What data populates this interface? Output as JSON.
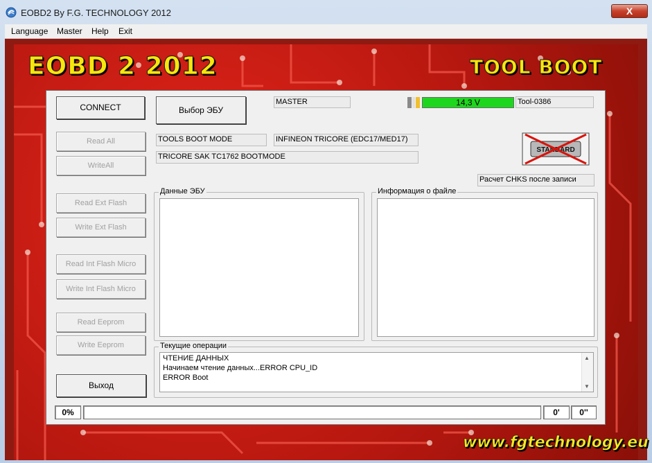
{
  "window": {
    "title": "EOBD2 By F.G. TECHNOLOGY 2012",
    "close_label": "X"
  },
  "menu": {
    "items": [
      "Language",
      "Master",
      "Help",
      "Exit"
    ]
  },
  "branding": {
    "logo_left": "EOBD 2 2012",
    "logo_right": "TOOL BOOT",
    "website": "www.fgtechnology.eu",
    "accent_yellow": "#f7e60b",
    "pcb_red": "#c81d12"
  },
  "buttons": {
    "connect": "CONNECT",
    "select_ecu": "Выбор ЭБУ",
    "read_all": "Read All",
    "write_all": "WriteAll",
    "read_ext_flash": "Read Ext Flash",
    "write_ext_flash": "Write Ext Flash",
    "read_int_flash_micro": "Read Int Flash Micro",
    "write_int_flash_micro": "Write Int Flash Micro",
    "read_eeprom": "Read Eeprom",
    "write_eeprom": "Write Eeprom",
    "exit": "Выход"
  },
  "status": {
    "mode_label": "MASTER",
    "voltage": "14,3 V",
    "voltage_color": "#1ed61e",
    "tool_id": "Tool-0386",
    "boot_mode": "TOOLS BOOT MODE",
    "processor": "INFINEON TRICORE (EDC17/MED17)",
    "bootmode_detail": "TRICORE SAK TC1762  BOOTMODE",
    "chks": "Расчет CHKS после записи",
    "standard_icon": "standard-crossed-icon",
    "standard_text": "STANDARD"
  },
  "groups": {
    "ecu_data": "Данные ЭБУ",
    "file_info": "Информация о файле",
    "current_ops": "Текущие операции"
  },
  "log": {
    "lines": [
      "ЧТЕНИЕ ДАННЫХ",
      "Начинаем чтение данных...ERROR CPU_ID",
      "ERROR Boot"
    ]
  },
  "progress": {
    "percent": "0%",
    "minutes": "0'",
    "seconds": "0''"
  }
}
